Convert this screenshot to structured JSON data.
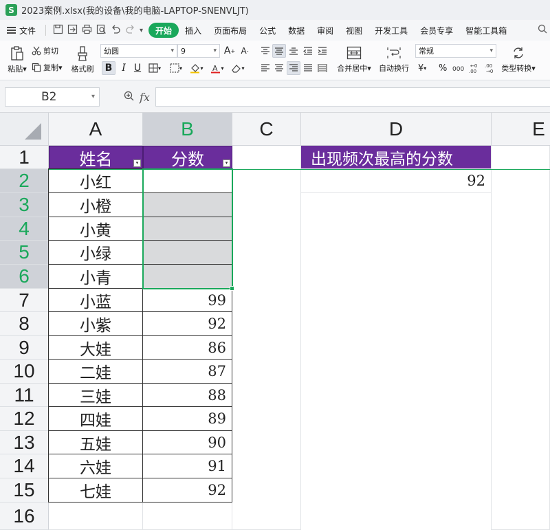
{
  "window": {
    "title": "2023案例.xlsx(我的设备\\我的电脑-LAPTOP-SNENVLJT)",
    "logo_letter": "S"
  },
  "menu": {
    "file_label": "文件",
    "tabs": [
      {
        "label": "开始",
        "active": true
      },
      {
        "label": "插入"
      },
      {
        "label": "页面布局"
      },
      {
        "label": "公式"
      },
      {
        "label": "数据"
      },
      {
        "label": "审阅"
      },
      {
        "label": "视图"
      },
      {
        "label": "开发工具"
      },
      {
        "label": "会员专享"
      },
      {
        "label": "智能工具箱"
      }
    ]
  },
  "ribbon": {
    "paste": "粘贴",
    "cut": "剪切",
    "copy": "复制",
    "format_painter": "格式刷",
    "font_name": "幼圆",
    "font_size": "9",
    "merge_center": "合并居中",
    "wrap_text": "自动换行",
    "number_format": "常规",
    "type_convert": "类型转换",
    "currency_symbol": "¥",
    "percent_symbol": "%"
  },
  "formula_bar": {
    "name_box": "B2",
    "fx_label": "fx",
    "content": ""
  },
  "columns": [
    "A",
    "B",
    "C",
    "D",
    "E"
  ],
  "rows": [
    "1",
    "2",
    "3",
    "4",
    "5",
    "6",
    "7",
    "8",
    "9",
    "10",
    "11",
    "12",
    "13",
    "14",
    "15",
    "16"
  ],
  "sheet": {
    "header_name": "姓名",
    "header_score": "分数",
    "header_mode": "出现频次最高的分数",
    "mode_value": "92",
    "records": [
      {
        "name": "小红",
        "score": ""
      },
      {
        "name": "小橙",
        "score": ""
      },
      {
        "name": "小黄",
        "score": ""
      },
      {
        "name": "小绿",
        "score": ""
      },
      {
        "name": "小青",
        "score": ""
      },
      {
        "name": "小蓝",
        "score": "99"
      },
      {
        "name": "小紫",
        "score": "92"
      },
      {
        "name": "大娃",
        "score": "86"
      },
      {
        "name": "二娃",
        "score": "87"
      },
      {
        "name": "三娃",
        "score": "88"
      },
      {
        "name": "四娃",
        "score": "89"
      },
      {
        "name": "五娃",
        "score": "90"
      },
      {
        "name": "六娃",
        "score": "91"
      },
      {
        "name": "七娃",
        "score": "92"
      }
    ]
  },
  "colors": {
    "accent": "#1aa85b",
    "header_fill": "#6a2d9c",
    "selection_fill": "#d9dadc"
  }
}
